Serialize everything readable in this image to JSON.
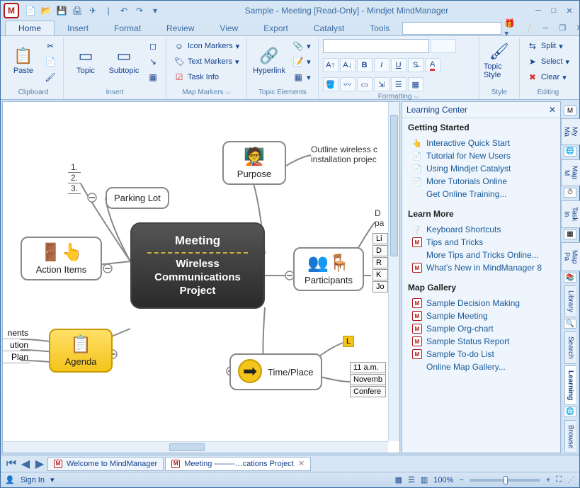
{
  "title": "Sample - Meeting [Read-Only] - Mindjet MindManager",
  "menu": {
    "tabs": [
      "Home",
      "Insert",
      "Format",
      "Review",
      "View",
      "Export",
      "Catalyst",
      "Tools"
    ],
    "active": 0
  },
  "ribbon": {
    "clipboard": {
      "label": "Clipboard",
      "paste": "Paste"
    },
    "insert": {
      "label": "Insert",
      "topic": "Topic",
      "subtopic": "Subtopic"
    },
    "map_markers": {
      "label": "Map Markers",
      "icon_markers": "Icon Markers",
      "text_markers": "Text Markers",
      "task_info": "Task Info"
    },
    "topic_elements": {
      "label": "Topic Elements",
      "hyperlink": "Hyperlink"
    },
    "formatting": {
      "label": "Formatting"
    },
    "style": {
      "label": "Style",
      "topic_style": "Topic Style"
    },
    "editing": {
      "label": "Editing",
      "split": "Split",
      "select": "Select",
      "clear": "Clear"
    }
  },
  "map": {
    "central": {
      "title": "Meeting",
      "subtitle": "Wireless Communications Project"
    },
    "parking_lot": "Parking Lot",
    "action_items": "Action Items",
    "agenda": "Agenda",
    "purpose": "Purpose",
    "participants": "Participants",
    "time_place": "Time/Place",
    "purpose_note": "Outline wireless c installation projec",
    "numbers": [
      "1.",
      "2.",
      "3."
    ],
    "agenda_items": [
      "nents",
      "ution",
      "Plan"
    ],
    "participants_header": "D",
    "participants_sub": "pa",
    "participants_list": [
      "Li",
      "D",
      "R",
      "K",
      "Jo"
    ],
    "time_place_badge": "L",
    "time_place_list": [
      "11 a.m.",
      "Novemb",
      "Confere"
    ]
  },
  "learning_center": {
    "title": "Learning Center",
    "sections": [
      {
        "heading": "Getting Started",
        "links": [
          "Interactive Quick Start",
          "Tutorial for New Users",
          "Using Mindjet Catalyst",
          "More Tutorials Online",
          "Get Online Training..."
        ]
      },
      {
        "heading": "Learn More",
        "links": [
          "Keyboard Shortcuts",
          "Tips and Tricks",
          "More Tips and Tricks Online...",
          "What's New in MindManager 8"
        ]
      },
      {
        "heading": "Map Gallery",
        "links": [
          "Sample Decision Making",
          "Sample Meeting",
          "Sample Org-chart",
          "Sample Status Report",
          "Sample To-do List",
          "Online Map Gallery..."
        ]
      }
    ]
  },
  "righttabs": [
    "My Ma",
    "Map M",
    "Task In",
    "Map Pa",
    "Library",
    "Search",
    "Learning",
    "Browse"
  ],
  "righttabs_active": 6,
  "doctabs": {
    "tab1": "Welcome to MindManager",
    "tab2": "Meeting --------…cations Project"
  },
  "status": {
    "signin": "Sign In",
    "zoom": "100%"
  }
}
